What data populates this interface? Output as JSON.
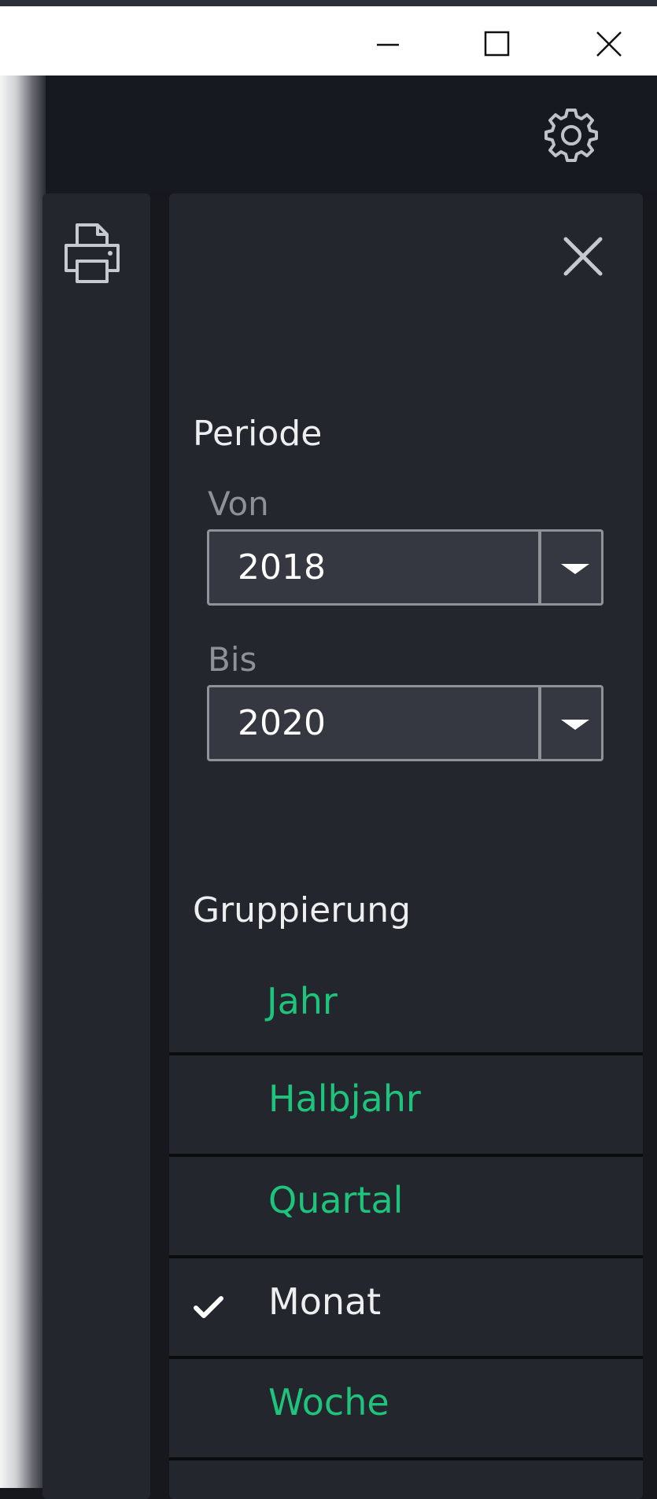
{
  "window_controls": {
    "minimize_icon": "minimize-icon",
    "maximize_icon": "maximize-icon",
    "close_icon": "close-icon"
  },
  "app_bar": {
    "settings_icon": "gear-icon"
  },
  "left_panel": {
    "print_icon": "printer-icon"
  },
  "filter_panel": {
    "close_icon": "close-icon",
    "period": {
      "title": "Periode",
      "from_label": "Von",
      "from_value": "2018",
      "to_label": "Bis",
      "to_value": "2020"
    },
    "grouping": {
      "title": "Gruppierung",
      "items": [
        {
          "label": "Jahr",
          "selected": false
        },
        {
          "label": "Halbjahr",
          "selected": false
        },
        {
          "label": "Quartal",
          "selected": false
        },
        {
          "label": "Monat",
          "selected": true
        },
        {
          "label": "Woche",
          "selected": false
        }
      ]
    }
  },
  "colors": {
    "accent": "#1fc47c",
    "background": "#23262c",
    "app_bar": "#161920",
    "text": "#eceef0"
  }
}
